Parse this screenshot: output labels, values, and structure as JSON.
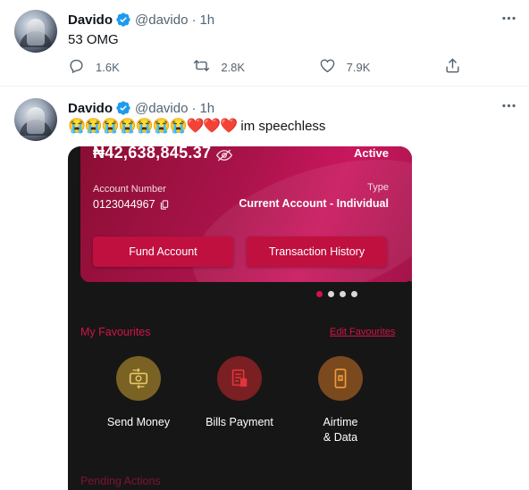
{
  "tweets": [
    {
      "name": "Davido",
      "handle": "@davido",
      "separator": "·",
      "time": "1h",
      "text": "53 OMG",
      "actions": {
        "reply": "1.6K",
        "retweet": "2.8K",
        "like": "7.9K"
      }
    },
    {
      "name": "Davido",
      "handle": "@davido",
      "separator": "·",
      "time": "1h",
      "emojis": "😭😭😭😭😭😭😭",
      "hearts": "❤️❤️❤️",
      "text": " im speechless"
    }
  ],
  "media": {
    "balance": "₦42,638,845.37",
    "status": "Active",
    "account_number_label": "Account Number",
    "account_number": "0123044967",
    "type_label": "Type",
    "type_value": "Current Account - Individual",
    "fund_button": "Fund Account",
    "history_button": "Transaction History",
    "carousel_pages": 4,
    "carousel_active": 1,
    "favourites_title": "My Favourites",
    "edit_favourites": "Edit Favourites",
    "favourites": [
      {
        "label": "Send Money"
      },
      {
        "label": "Bills Payment"
      },
      {
        "label": "Airtime\n& Data"
      }
    ],
    "pending_title": "Pending Actions"
  },
  "colors": {
    "verified": "#1d9bf0",
    "muted": "#536471",
    "brand": "#c0103f",
    "accent": "#d11447"
  },
  "icons": [
    "verified-badge-icon",
    "more-icon",
    "reply-icon",
    "retweet-icon",
    "like-icon",
    "share-icon",
    "hide-eye-icon",
    "copy-icon",
    "money-transfer-icon",
    "bill-icon",
    "phone-icon"
  ]
}
